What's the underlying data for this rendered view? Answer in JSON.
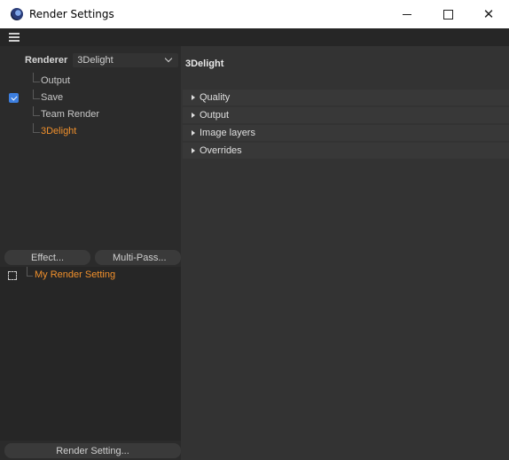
{
  "window": {
    "title": "Render Settings",
    "controls": {
      "minimize": "—",
      "maximize": "☐",
      "close": "✕"
    }
  },
  "renderer": {
    "label": "Renderer",
    "selected": "3Delight"
  },
  "tree": [
    {
      "label": "Output",
      "checked": false,
      "active": false
    },
    {
      "label": "Save",
      "checked": true,
      "active": false
    },
    {
      "label": "Team Render",
      "checked": false,
      "active": false
    },
    {
      "label": "3Delight",
      "checked": false,
      "active": true
    }
  ],
  "buttons": {
    "effect": "Effect...",
    "multipass": "Multi-Pass...",
    "render_setting": "Render Setting..."
  },
  "render_settings": [
    {
      "label": "My Render Setting"
    }
  ],
  "main": {
    "title": "3Delight",
    "groups": [
      "Quality",
      "Output",
      "Image layers",
      "Overrides"
    ]
  },
  "colors": {
    "accent": "#f0902c",
    "checkbox": "#3d7fe0",
    "panel": "#333333",
    "sidebar": "#2b2b2b"
  }
}
